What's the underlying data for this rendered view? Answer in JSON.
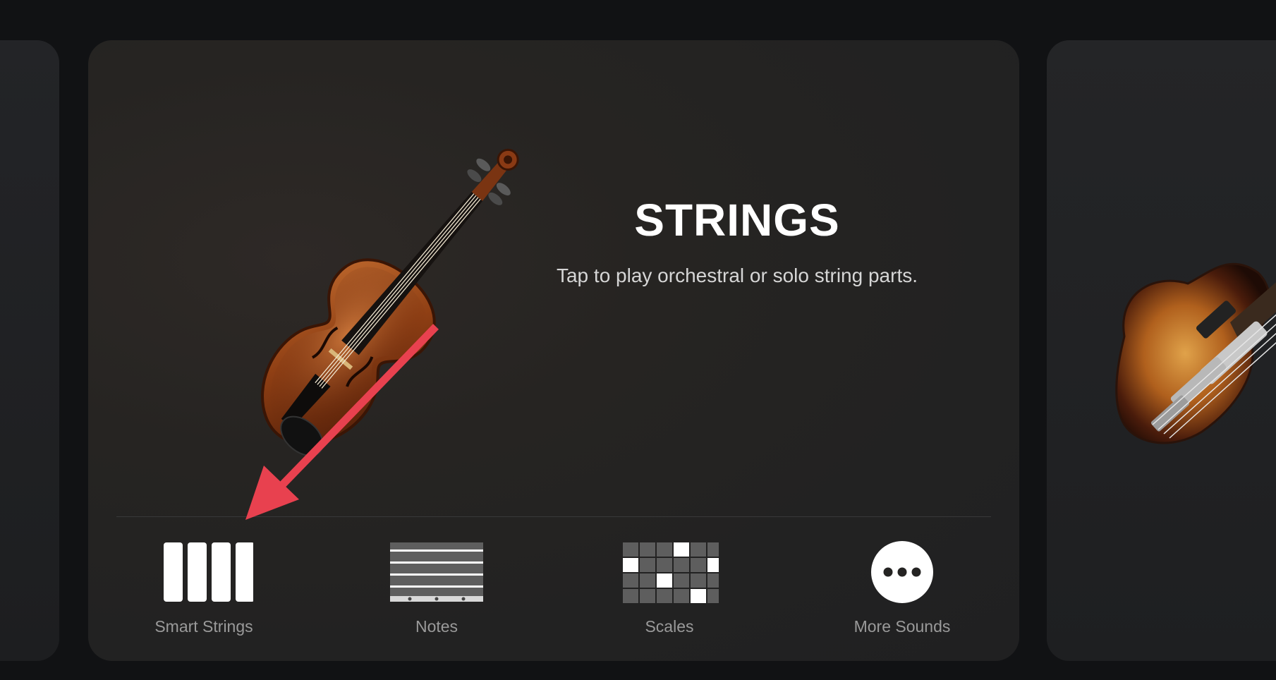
{
  "instrument": {
    "title": "STRINGS",
    "description": "Tap to play orchestral or solo string parts.",
    "image_icon": "violin-icon"
  },
  "modes": [
    {
      "label": "Smart Strings",
      "icon": "smart-strings-icon"
    },
    {
      "label": "Notes",
      "icon": "notes-icon"
    },
    {
      "label": "Scales",
      "icon": "scales-icon"
    },
    {
      "label": "More Sounds",
      "icon": "more-sounds-icon"
    }
  ],
  "adjacent_cards": {
    "right_icon": "bass-guitar-icon"
  },
  "annotation": {
    "type": "arrow",
    "color": "#e8414f",
    "target": "Smart Strings"
  },
  "colors": {
    "background": "#111214",
    "card": "#242322",
    "title": "#ffffff",
    "label": "#9a9a9a",
    "annotation": "#e8414f"
  }
}
